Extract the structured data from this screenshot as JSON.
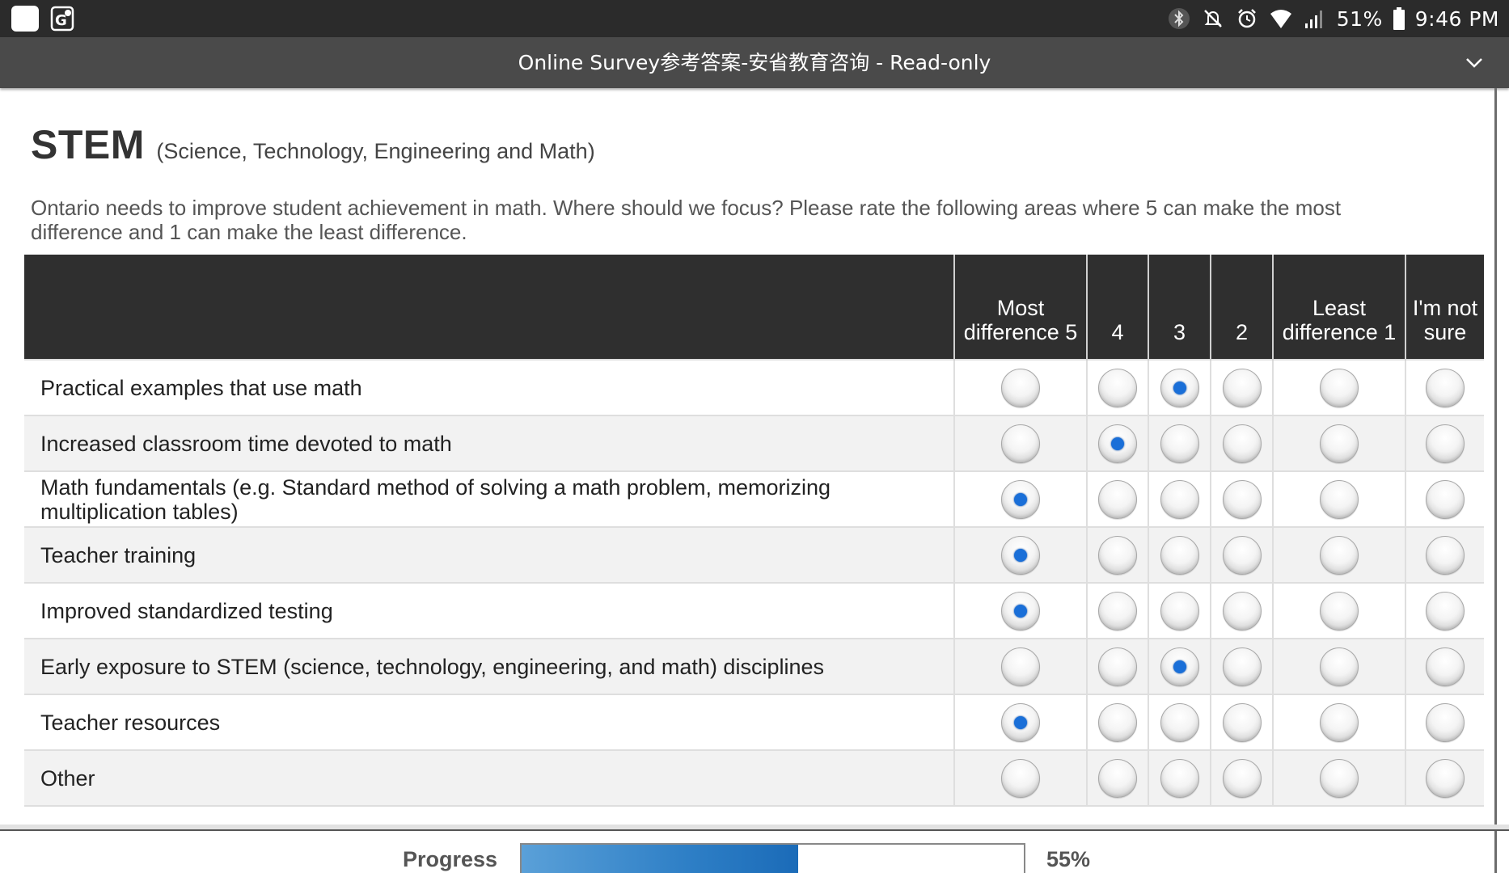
{
  "statusbar": {
    "battery": "51%",
    "time": "9:46 PM"
  },
  "titlebar": {
    "title": "Online Survey参考答案-安省教育咨询 - Read-only"
  },
  "section": {
    "title": "STEM",
    "subtitle": "(Science, Technology, Engineering and Math)",
    "intro": "Ontario needs to improve student achievement in math. Where should we focus? Please rate the following areas where 5 can make the most difference and 1 can make the least difference."
  },
  "matrix": {
    "columns": [
      {
        "label": "Most difference 5"
      },
      {
        "label": "4"
      },
      {
        "label": "3"
      },
      {
        "label": "2"
      },
      {
        "label": "Least difference 1"
      },
      {
        "label": "I'm not sure"
      }
    ],
    "rows": [
      {
        "label": "Practical examples that use math",
        "selected": "3"
      },
      {
        "label": "Increased classroom time devoted to math",
        "selected": "4"
      },
      {
        "label": "Math fundamentals (e.g. Standard method of solving a math problem, memorizing multiplication tables)",
        "selected": "5"
      },
      {
        "label": "Teacher training",
        "selected": "5"
      },
      {
        "label": "Improved standardized testing",
        "selected": "5"
      },
      {
        "label": "Early exposure to STEM (science, technology, engineering, and math) disciplines",
        "selected": "3"
      },
      {
        "label": "Teacher resources",
        "selected": "5"
      },
      {
        "label": "Other",
        "selected": null
      }
    ]
  },
  "progress": {
    "label": "Progress",
    "percent_text": "55%",
    "fraction": 0.55
  },
  "colors": {
    "statusbar_bg": "#2b2b2b",
    "titlebar_bg": "#4a4a4a",
    "header_bg": "#2f2f2f",
    "radio_selected": "#1a6fd8",
    "progress_fill": "#2e7fc6"
  }
}
